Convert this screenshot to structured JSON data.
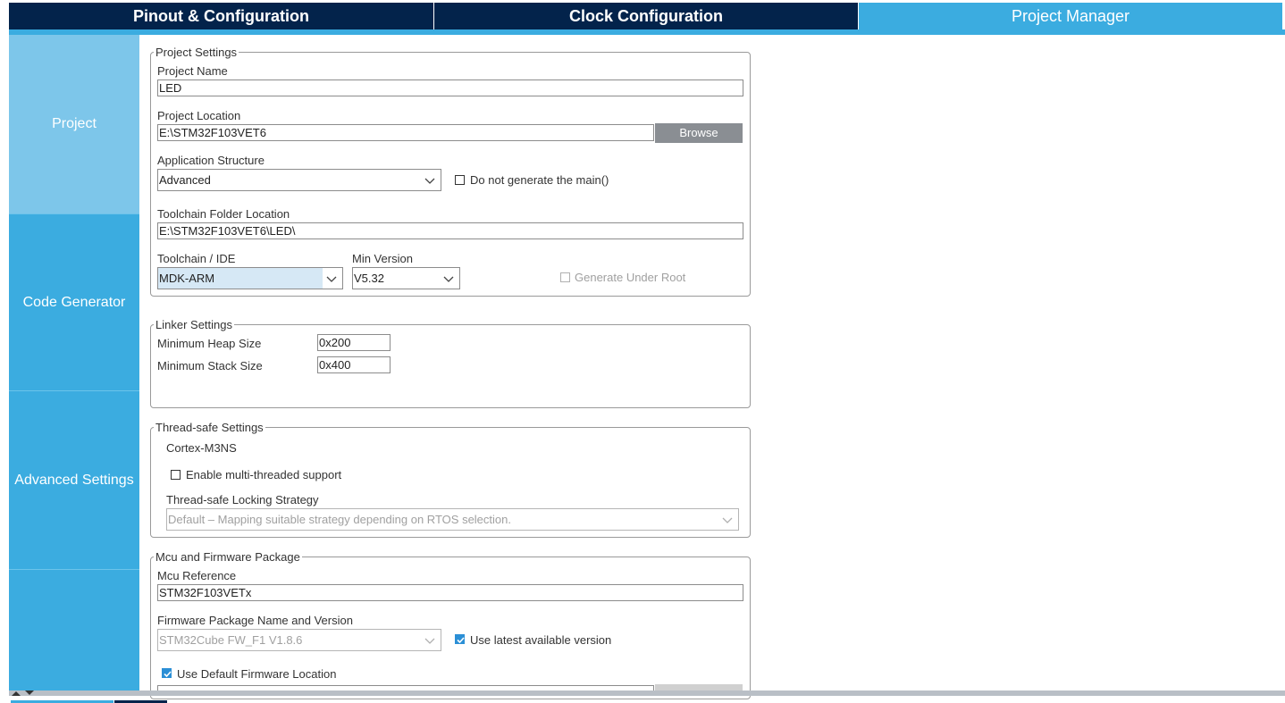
{
  "tabs": [
    {
      "label": "Pinout & Configuration"
    },
    {
      "label": "Clock Configuration"
    },
    {
      "label": "Project Manager"
    }
  ],
  "sidebar": {
    "items": [
      {
        "label": "Project"
      },
      {
        "label": "Code Generator"
      },
      {
        "label": "Advanced Settings"
      }
    ]
  },
  "project_settings": {
    "legend": "Project Settings",
    "project_name_label": "Project Name",
    "project_name_value": "LED",
    "project_location_label": "Project Location",
    "project_location_value": "E:\\STM32F103VET6",
    "browse_label": "Browse",
    "app_structure_label": "Application Structure",
    "app_structure_value": "Advanced",
    "no_main_label": "Do not generate the main()",
    "toolchain_folder_label": "Toolchain Folder Location",
    "toolchain_folder_value": "E:\\STM32F103VET6\\LED\\",
    "toolchain_ide_label": "Toolchain / IDE",
    "toolchain_ide_value": "MDK-ARM",
    "min_version_label": "Min Version",
    "min_version_value": "V5.32",
    "generate_under_root_label": "Generate Under Root"
  },
  "linker_settings": {
    "legend": "Linker Settings",
    "heap_label": "Minimum Heap Size",
    "heap_value": "0x200",
    "stack_label": "Minimum Stack Size",
    "stack_value": "0x400"
  },
  "thread_safe": {
    "legend": "Thread-safe Settings",
    "core": "Cortex-M3NS",
    "multithread_label": "Enable multi-threaded support",
    "strategy_label": "Thread-safe Locking Strategy",
    "strategy_value": "Default  –  Mapping suitable strategy depending on RTOS selection."
  },
  "mcu_firmware": {
    "legend": "Mcu and Firmware Package",
    "mcu_ref_label": "Mcu Reference",
    "mcu_ref_value": "STM32F103VETx",
    "fw_label": "Firmware Package Name and Version",
    "fw_value": "STM32Cube FW_F1 V1.8.6",
    "use_latest_label": "Use latest available version",
    "use_default_fw_label": "Use Default Firmware Location"
  },
  "colors": {
    "tab_dark": "#03234b",
    "accent": "#3bace0",
    "sidebar_active": "#7dc6ea",
    "button_gray": "#8a8e93",
    "checkbox_checked": "#2b8fd6"
  }
}
